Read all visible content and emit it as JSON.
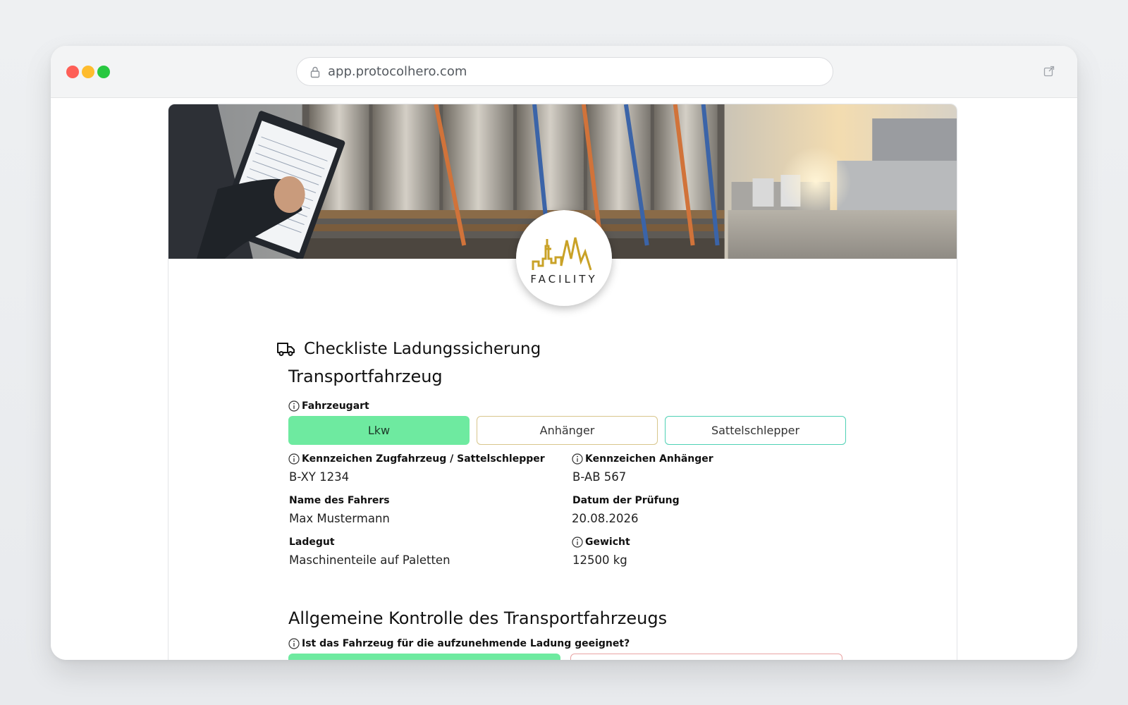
{
  "browser": {
    "url": "app.protocolhero.com"
  },
  "logo": {
    "text": "FACILITY",
    "color": "#c9a227"
  },
  "form": {
    "title": "Checkliste Ladungssicherung",
    "title_icon": "truck-icon",
    "section1": {
      "heading": "Transportfahrzeug",
      "vehicle_type_label": "Fahrzeugart",
      "vehicle_type_options": [
        "Lkw",
        "Anhänger",
        "Sattelschlepper"
      ],
      "vehicle_type_selected": "Lkw",
      "fields": {
        "plate_tractor_label": "Kennzeichen Zugfahrzeug / Sattelschlepper",
        "plate_tractor_value": "B-XY 1234",
        "plate_trailer_label": "Kennzeichen Anhänger",
        "plate_trailer_value": "B-AB 567",
        "driver_label": "Name des Fahrers",
        "driver_value": "Max Mustermann",
        "date_label": "Datum der Prüfung",
        "date_value": "20.08.2026",
        "cargo_label": "Ladegut",
        "cargo_value": "Maschinenteile auf Paletten",
        "weight_label": "Gewicht",
        "weight_value": "12500 kg"
      }
    },
    "section2": {
      "heading": "Allgemeine Kontrolle des Transportfahrzeugs",
      "question1": "Ist das Fahrzeug für die aufzunehmende Ladung geeignet?"
    }
  },
  "colors": {
    "selected_green": "#6eeaa0",
    "option_anhaenger_border": "#d8c68c",
    "option_sattel_border": "#4fd1b5",
    "yes_green": "#6eeaa0",
    "no_red_border": "#e9a3a3"
  }
}
